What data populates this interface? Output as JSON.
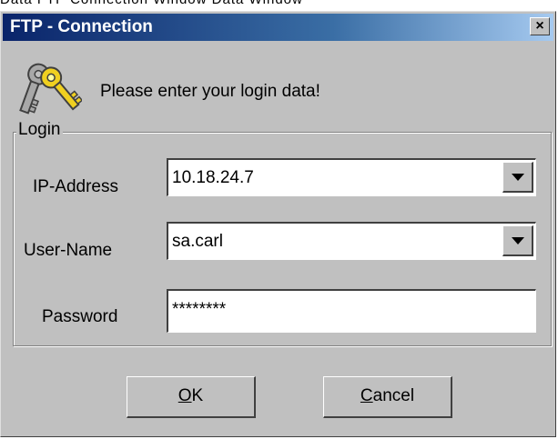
{
  "window": {
    "title": "FTP - Connection",
    "close_glyph": "×"
  },
  "top_strip_text": "Data FTP Connection Window Data Window",
  "intro": {
    "icon": "keys-icon",
    "text": "Please enter your login data!"
  },
  "login_group": {
    "legend": "Login",
    "fields": [
      {
        "label": "IP-Address",
        "value": "10.18.24.7",
        "type": "combo"
      },
      {
        "label": "User-Name",
        "value": "sa.carl",
        "type": "combo"
      },
      {
        "label": "Password",
        "value": "********",
        "type": "password"
      }
    ]
  },
  "buttons": {
    "ok": {
      "mnemonic": "O",
      "rest": "K"
    },
    "cancel": {
      "mnemonic": "C",
      "rest": "ancel"
    }
  },
  "colors": {
    "dialog_bg": "#c0c0c0",
    "titlebar_start": "#0a246a",
    "titlebar_end": "#a6caf0",
    "field_bg": "#ffffff"
  }
}
